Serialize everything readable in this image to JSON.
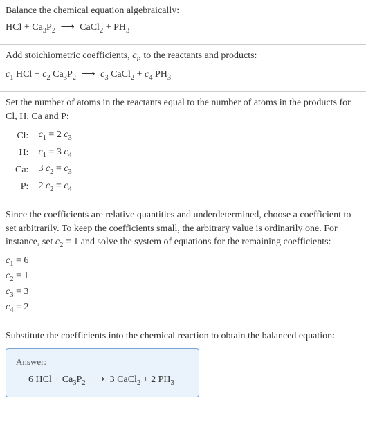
{
  "sections": {
    "balance": {
      "intro": "Balance the chemical equation algebraically:",
      "equation": "HCl + Ca_3P_2 ⟶ CaCl_2 + PH_3"
    },
    "addcoef": {
      "intro_pre": "Add stoichiometric coefficients, ",
      "intro_var": "c_i",
      "intro_post": ", to the reactants and products:",
      "equation": "c_1 HCl + c_2 Ca_3P_2 ⟶ c_3 CaCl_2 + c_4 PH_3"
    },
    "atoms": {
      "intro": "Set the number of atoms in the reactants equal to the number of atoms in the products for Cl, H, Ca and P:",
      "rows": [
        {
          "label": "Cl:",
          "eq": "c_1 = 2 c_3"
        },
        {
          "label": "H:",
          "eq": "c_1 = 3 c_4"
        },
        {
          "label": "Ca:",
          "eq": "3 c_2 = c_3"
        },
        {
          "label": "P:",
          "eq": "2 c_2 = c_4"
        }
      ]
    },
    "relative": {
      "intro_pre": "Since the coefficients are relative quantities and underdetermined, choose a coefficient to set arbitrarily. To keep the coefficients small, the arbitrary value is ordinarily one. For instance, set ",
      "intro_var": "c_2 = 1",
      "intro_post": " and solve the system of equations for the remaining coefficients:",
      "coeffs": [
        "c_1 = 6",
        "c_2 = 1",
        "c_3 = 3",
        "c_4 = 2"
      ]
    },
    "substitute": {
      "intro": "Substitute the coefficients into the chemical reaction to obtain the balanced equation:"
    },
    "answer": {
      "label": "Answer:",
      "equation": "6 HCl + Ca_3P_2 ⟶ 3 CaCl_2 + 2 PH_3"
    }
  },
  "chart_data": {
    "type": "table",
    "title": "Balanced chemical equation stoichiometry",
    "reaction_unbalanced": "HCl + Ca3P2 -> CaCl2 + PH3",
    "atom_balance_equations": {
      "Cl": "c1 = 2 c3",
      "H": "c1 = 3 c4",
      "Ca": "3 c2 = c3",
      "P": "2 c2 = c4"
    },
    "fixed_variable": "c2 = 1",
    "solved_coefficients": {
      "c1": 6,
      "c2": 1,
      "c3": 3,
      "c4": 2
    },
    "reaction_balanced": "6 HCl + Ca3P2 -> 3 CaCl2 + 2 PH3"
  }
}
